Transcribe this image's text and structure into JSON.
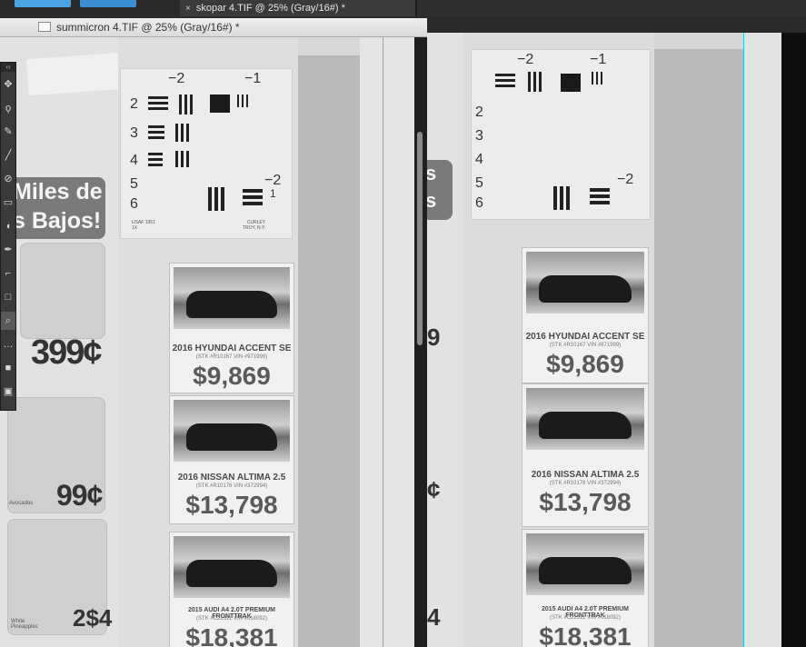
{
  "tabs": {
    "active_doc": "skopar 4.TIF @ 25% (Gray/16#) *",
    "close_symbol": "×"
  },
  "front_window": {
    "title": "summicron 4.TIF @ 25% (Gray/16#) *"
  },
  "toolbox": {
    "collapse_label": "‹‹",
    "tools": [
      {
        "name": "move-tool",
        "glyph": "✥"
      },
      {
        "name": "lasso-tool",
        "glyph": "ϙ"
      },
      {
        "name": "brush-tool",
        "glyph": "✎"
      },
      {
        "name": "line-tool",
        "glyph": "╱"
      },
      {
        "name": "clone-tool",
        "glyph": "⊘"
      },
      {
        "name": "eraser-tool",
        "glyph": "▭"
      },
      {
        "name": "dodge-tool",
        "glyph": "◖"
      },
      {
        "name": "pen-tool",
        "glyph": "✒"
      },
      {
        "name": "crop-tool",
        "glyph": "⌐"
      },
      {
        "name": "shape-tool",
        "glyph": "□"
      },
      {
        "name": "zoom-tool",
        "glyph": "⌕"
      },
      {
        "name": "hand-tool",
        "glyph": "…"
      },
      {
        "name": "color-swatch",
        "glyph": "■"
      },
      {
        "name": "quickmask-tool",
        "glyph": "▣"
      }
    ],
    "selected_index": 10
  },
  "chart": {
    "group_minus2": "−2",
    "group_minus1": "−1",
    "group_2": "−2",
    "group_1": "1",
    "rows": [
      "2",
      "3",
      "4",
      "5",
      "6"
    ],
    "footer_left": "USAF 1951\n1X",
    "footer_right": "CURLEY\nTROY, N.Y."
  },
  "flyer": {
    "banner_line1": "Miles de",
    "banner_line2": "s Bajos!",
    "price1": "399¢",
    "price2": "99¢",
    "price3": "2$4",
    "label_avocado": "Avocados",
    "label_pine": "White Pineapples"
  },
  "cars": [
    {
      "title": "2016 HYUNDAI ACCENT SE",
      "stk": "(STK #R10167 VIN #971999)",
      "price": "$9,869"
    },
    {
      "title": "2016 NISSAN ALTIMA 2.5",
      "stk": "(STK #R10176 VIN #372994)",
      "price": "$13,798"
    },
    {
      "title": "2015 AUDI A4 2.0T PREMIUM FRONTTRAK",
      "stk": "(STK #C22311 VIN #018092)",
      "price": "$18,381"
    }
  ],
  "colors": {
    "guide": "#2ec9e8",
    "accent_button": "#4aa3e0"
  }
}
